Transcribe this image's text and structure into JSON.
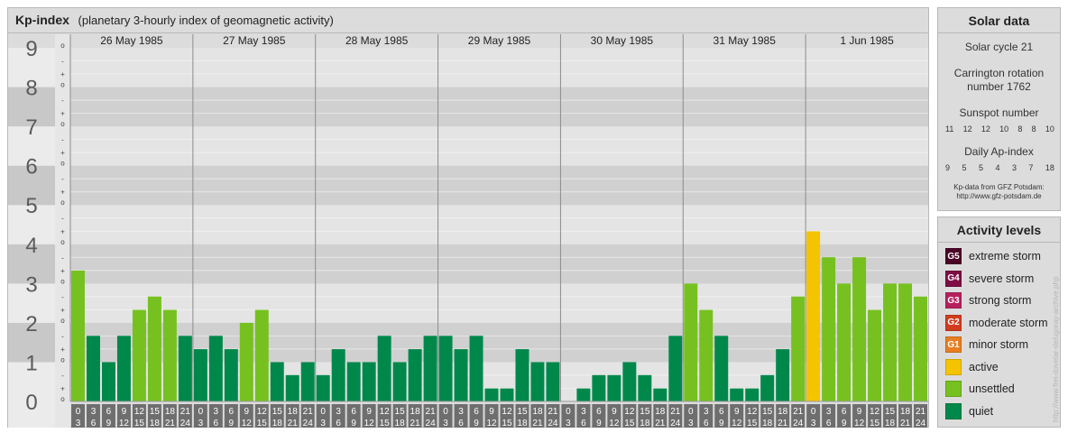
{
  "title": "Kp-index",
  "subtitle": "(planetary 3-hourly index of geomagnetic activity)",
  "colors": {
    "quiet": "#00884b",
    "unsettled": "#76c120",
    "active": "#f5c400",
    "minor_storm": "#e67e22",
    "moderate_storm": "#d13d1f",
    "strong_storm": "#b6205e",
    "severe_storm": "#7d0f45",
    "extreme_storm": "#4a0526"
  },
  "chart_data": {
    "type": "bar",
    "title": "Kp-index",
    "subtitle": "(planetary 3-hourly index of geomagnetic activity)",
    "ylim": [
      0,
      9
    ],
    "y_major_ticks": [
      "0",
      "1",
      "2",
      "3",
      "4",
      "5",
      "6",
      "7",
      "8",
      "9"
    ],
    "y_minor_ticks": [
      "-",
      "o",
      "+"
    ],
    "interval_labels": [
      [
        "0",
        "3"
      ],
      [
        "3",
        "6"
      ],
      [
        "6",
        "9"
      ],
      [
        "9",
        "12"
      ],
      [
        "12",
        "15"
      ],
      [
        "15",
        "18"
      ],
      [
        "18",
        "21"
      ],
      [
        "21",
        "24"
      ]
    ],
    "days": [
      {
        "date": "26 May 1985",
        "kp": [
          3.33,
          1.67,
          1.0,
          1.67,
          2.33,
          2.67,
          2.33,
          1.67
        ]
      },
      {
        "date": "27 May 1985",
        "kp": [
          1.33,
          1.67,
          1.33,
          2.0,
          2.33,
          1.0,
          0.67,
          1.0
        ]
      },
      {
        "date": "28 May 1985",
        "kp": [
          0.67,
          1.33,
          1.0,
          1.0,
          1.67,
          1.0,
          1.33,
          1.67
        ]
      },
      {
        "date": "29 May 1985",
        "kp": [
          1.67,
          1.33,
          1.67,
          0.33,
          0.33,
          1.33,
          1.0,
          1.0
        ]
      },
      {
        "date": "30 May 1985",
        "kp": [
          0.0,
          0.33,
          0.67,
          0.67,
          1.0,
          0.67,
          0.33,
          1.67
        ]
      },
      {
        "date": "31 May 1985",
        "kp": [
          3.0,
          2.33,
          1.67,
          0.33,
          0.33,
          0.67,
          1.33,
          2.67
        ]
      },
      {
        "date": "1 Jun 1985",
        "kp": [
          4.33,
          3.67,
          3.0,
          3.67,
          2.33,
          3.0,
          3.0,
          2.67
        ]
      }
    ]
  },
  "solar_data": {
    "title": "Solar data",
    "cycle_label": "Solar cycle 21",
    "carrington_line1": "Carrington rotation",
    "carrington_line2": "number 1762",
    "sunspot_label": "Sunspot number",
    "sunspot_values": [
      "11",
      "12",
      "12",
      "10",
      "8",
      "8",
      "10"
    ],
    "ap_label": "Daily Ap-index",
    "ap_values": [
      "9",
      "5",
      "5",
      "4",
      "3",
      "7",
      "18"
    ],
    "credit_line1": "Kp-data from GFZ Potsdam:",
    "credit_line2": "http://www.gfz-potsdam.de"
  },
  "activity_levels": {
    "title": "Activity levels",
    "items": [
      {
        "badge": "G5",
        "label": "extreme storm",
        "color": "#4a0526"
      },
      {
        "badge": "G4",
        "label": "severe storm",
        "color": "#7d0f45"
      },
      {
        "badge": "G3",
        "label": "strong storm",
        "color": "#b6205e"
      },
      {
        "badge": "G2",
        "label": "moderate storm",
        "color": "#d13d1f"
      },
      {
        "badge": "G1",
        "label": "minor storm",
        "color": "#e67e22"
      },
      {
        "badge": "",
        "label": "active",
        "color": "#f5c400"
      },
      {
        "badge": "",
        "label": "unsettled",
        "color": "#76c120"
      },
      {
        "badge": "",
        "label": "quiet",
        "color": "#00884b"
      }
    ]
  },
  "watermark": "http://www.frei-dovelar-de/ugoray-archive.php"
}
